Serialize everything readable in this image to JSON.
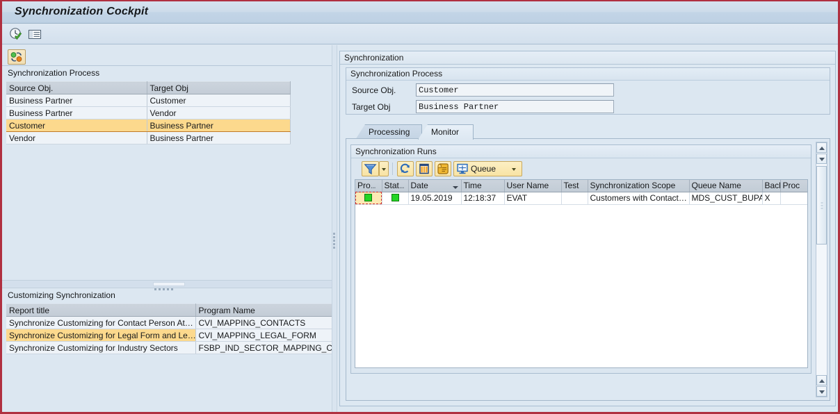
{
  "window": {
    "title": "Synchronization Cockpit"
  },
  "main_toolbar": {
    "buttons": [
      {
        "name": "execute-check-icon",
        "label": "Execute"
      },
      {
        "name": "list-view-icon",
        "label": "List"
      }
    ]
  },
  "left_panel": {
    "toolbar": {
      "sync_button_label": "Synchronization"
    },
    "sync_process": {
      "caption": "Synchronization Process",
      "columns": [
        "Source Obj.",
        "Target Obj"
      ],
      "rows": [
        {
          "source": "Business Partner",
          "target": "Customer",
          "selected": false
        },
        {
          "source": "Business Partner",
          "target": "Vendor",
          "selected": false
        },
        {
          "source": "Customer",
          "target": "Business Partner",
          "selected": true
        },
        {
          "source": "Vendor",
          "target": "Business Partner",
          "selected": false
        }
      ]
    },
    "customizing": {
      "caption": "Customizing Synchronization",
      "columns": [
        "Report title",
        "Program Name"
      ],
      "rows": [
        {
          "title": "Synchronize Customizing for Contact Person At…",
          "program": "CVI_MAPPING_CONTACTS",
          "selected": false
        },
        {
          "title": "Synchronize Customizing for Legal Form and Le…",
          "program": "CVI_MAPPING_LEGAL_FORM",
          "selected": true
        },
        {
          "title": "Synchronize Customizing for Industry Sectors",
          "program": "FSBP_IND_SECTOR_MAPPING_CHEC",
          "selected": false
        }
      ]
    }
  },
  "right_panel": {
    "caption": "Synchronization",
    "sync_process_group": {
      "title": "Synchronization Process",
      "source_label": "Source Obj.",
      "source_value": "Customer",
      "target_label": "Target Obj",
      "target_value": "Business Partner"
    },
    "tabs": [
      {
        "label": "Processing",
        "active": false
      },
      {
        "label": "Monitor",
        "active": true
      }
    ],
    "runs_group": {
      "title": "Synchronization Runs",
      "toolbar": [
        {
          "name": "filter-icon",
          "label": "Filter",
          "has_caret": true
        },
        {
          "name": "refresh-icon",
          "label": "Refresh",
          "has_caret": false
        },
        {
          "name": "columns-icon",
          "label": "Layout",
          "has_caret": false
        },
        {
          "name": "log-icon",
          "label": "Log",
          "has_caret": false
        },
        {
          "name": "queue-button",
          "label": "Queue",
          "has_caret": true
        }
      ],
      "columns": [
        "Pro",
        "Stat",
        "Date",
        "Time",
        "User Name",
        "Test",
        "Synchronization Scope",
        "Queue Name",
        "Back",
        "Proc"
      ],
      "column_truncation": {
        "Pro": "…",
        "Stat": "…"
      },
      "sorted_column": "Date",
      "rows": [
        {
          "process_status": "green",
          "status": "green",
          "date": "19.05.2019",
          "time": "12:18:37",
          "user_name": "EVAT",
          "test": "",
          "scope": "Customers with Contact…",
          "queue_name": "MDS_CUST_BUPA",
          "back": "X",
          "proc": ""
        }
      ]
    }
  },
  "colors": {
    "frame_red": "#b03040",
    "selection_orange": "#fcd98d",
    "status_green": "#24d524",
    "panel_blue": "#dce7f1"
  }
}
